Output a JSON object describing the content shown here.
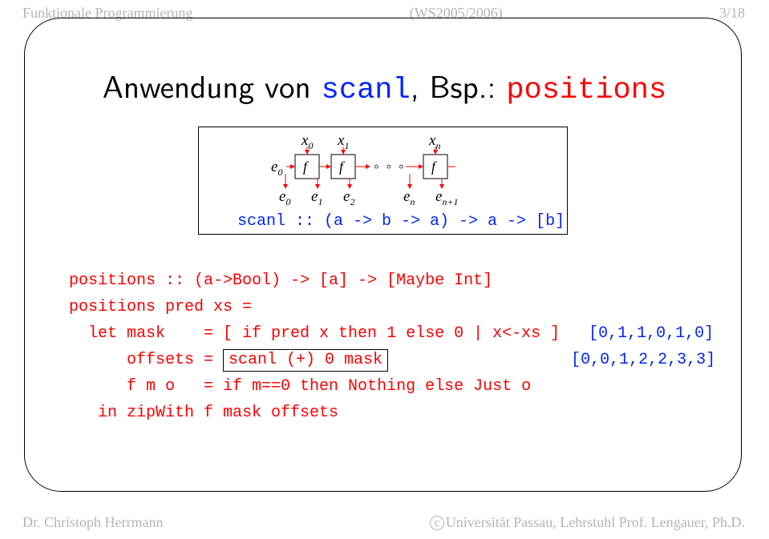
{
  "header": {
    "left": "Funktionale Programmierung",
    "center": "(WS2005/2006)",
    "right": "3/18"
  },
  "title": {
    "t1": "Anwendung von ",
    "scanl": "scanl",
    "t2": ", Bsp.: ",
    "positions": "positions"
  },
  "diagram": {
    "x0": "x",
    "x0s": "0",
    "x1": "x",
    "x1s": "1",
    "xn": "x",
    "xns": "n",
    "e0": "e",
    "e0s": "0",
    "f": "f",
    "dots": "◦ ◦ ◦",
    "e0b": "e",
    "e0bs": "0",
    "e1": "e",
    "e1s": "1",
    "e2": "e",
    "e2s": "2",
    "en": "e",
    "ens": "n",
    "en1": "e",
    "en1s": "n+1",
    "sig": "scanl :: (a -> b -> a) -> a -> [b] -> [a]"
  },
  "code": {
    "l1": "positions :: (a->Bool) -> [a] -> [Maybe Int]",
    "l2": "positions pred xs =",
    "l3a": "  let mask    = [ if pred x then 1 else 0 | x<-xs ]   ",
    "l3b": "[0,1,1,0,1,0]",
    "l4a": "      offsets = ",
    "l4b": "scanl (+) 0 mask",
    "l4c": "                   ",
    "l4d": "[0,0,1,2,2,3,3]",
    "l5": "      f m o   = if m==0 then Nothing else Just o",
    "l6": "   in zipWith f mask offsets"
  },
  "footer": {
    "left": "Dr. Christoph Herrmann",
    "right": "Universität Passau, Lehrstuhl Prof. Lengauer, Ph.D."
  }
}
